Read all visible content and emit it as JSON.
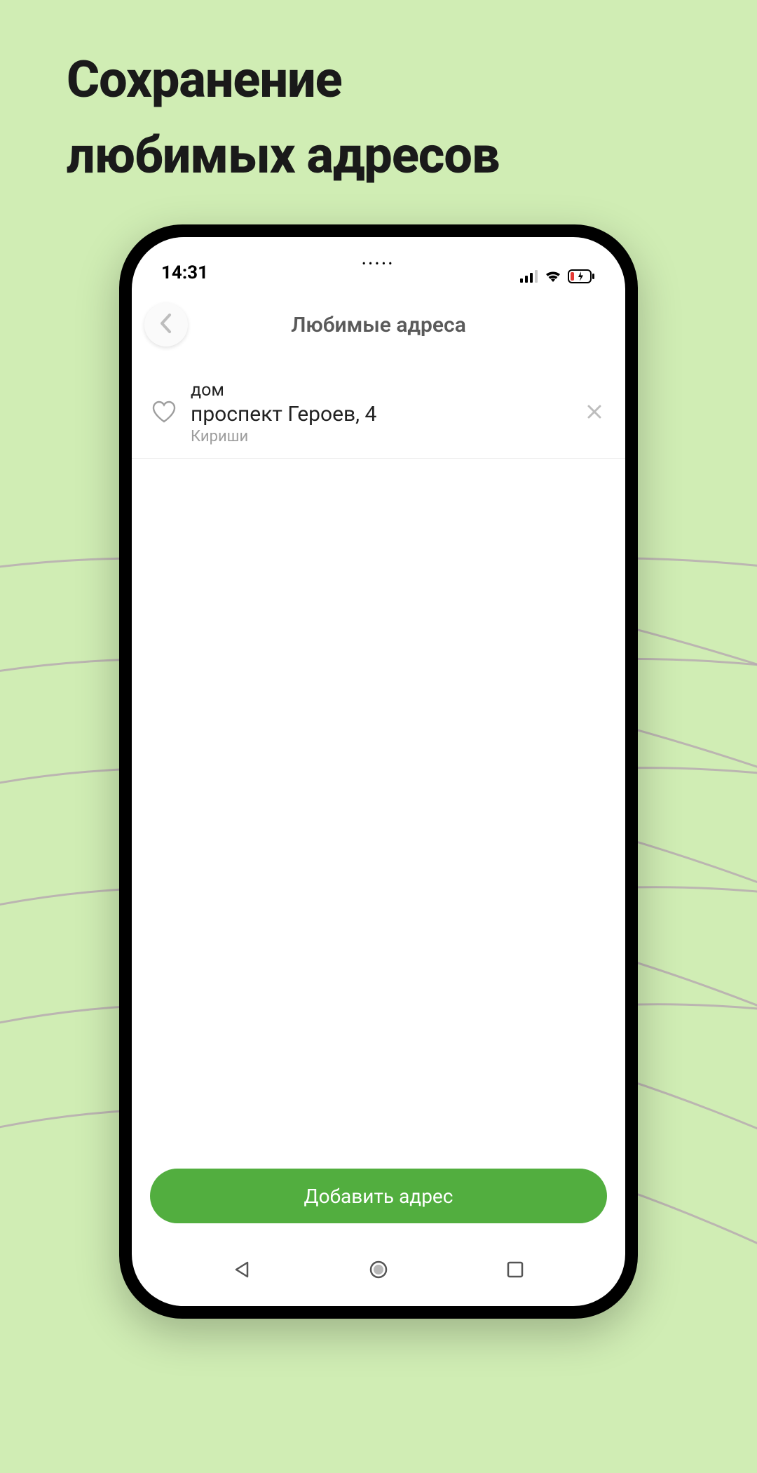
{
  "marketing": {
    "headline_line1": "Сохранение",
    "headline_line2": "любимых адресов"
  },
  "status": {
    "time": "14:31"
  },
  "header": {
    "title": "Любимые адреса"
  },
  "addresses": [
    {
      "label": "дом",
      "line": "проспект Героев, 4",
      "city": "Кириши"
    }
  ],
  "actions": {
    "add_address": "Добавить адрес"
  },
  "colors": {
    "accent": "#52ae3f",
    "background": "#d0edb4"
  }
}
